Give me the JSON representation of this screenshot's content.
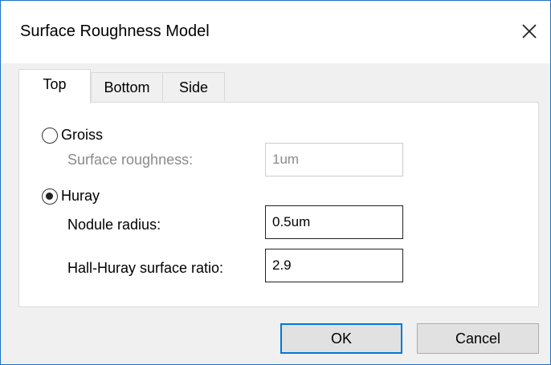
{
  "window": {
    "title": "Surface Roughness Model",
    "accent_color": "#0078d7",
    "close_icon": "close-icon"
  },
  "tabs": [
    {
      "label": "Top",
      "active": true
    },
    {
      "label": "Bottom",
      "active": false
    },
    {
      "label": "Side",
      "active": false
    }
  ],
  "groiss": {
    "label": "Groiss",
    "selected": false,
    "surface_roughness_label": "Surface roughness:",
    "surface_roughness_value": "1um"
  },
  "huray": {
    "label": "Huray",
    "selected": true,
    "nodule_radius_label": "Nodule radius:",
    "nodule_radius_value": "0.5um",
    "surface_ratio_label": "Hall-Huray surface ratio:",
    "surface_ratio_value": "2.9"
  },
  "buttons": {
    "ok_label": "OK",
    "cancel_label": "Cancel"
  }
}
